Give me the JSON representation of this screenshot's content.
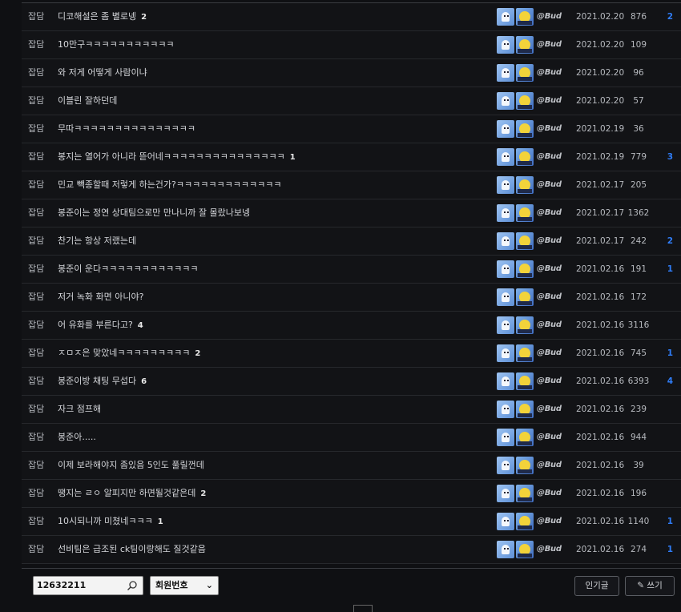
{
  "author": {
    "nickname": "@Bud"
  },
  "posts": [
    {
      "category": "잡담",
      "title": "디코해설은 좀 별로넹",
      "comments": "2",
      "date": "2021.02.20",
      "views": "876",
      "recommend": "2"
    },
    {
      "category": "잡담",
      "title": "10만구ㅋㅋㅋㅋㅋㅋㅋㅋㅋㅋㅋ",
      "comments": "",
      "date": "2021.02.20",
      "views": "109",
      "recommend": ""
    },
    {
      "category": "잡담",
      "title": "와 저게 어떻게 사람이냐",
      "comments": "",
      "date": "2021.02.20",
      "views": "96",
      "recommend": ""
    },
    {
      "category": "잡담",
      "title": "이블린 잘하던데",
      "comments": "",
      "date": "2021.02.20",
      "views": "57",
      "recommend": ""
    },
    {
      "category": "잡담",
      "title": "무따ㅋㅋㅋㅋㅋㅋㅋㅋㅋㅋㅋㅋㅋㅋㅋ",
      "comments": "",
      "date": "2021.02.19",
      "views": "36",
      "recommend": ""
    },
    {
      "category": "잡담",
      "title": "봉지는 열어가 아니라 뜯어네ㅋㅋㅋㅋㅋㅋㅋㅋㅋㅋㅋㅋㅋㅋㅋ",
      "comments": "1",
      "date": "2021.02.19",
      "views": "779",
      "recommend": "3"
    },
    {
      "category": "잡담",
      "title": "민교 빽종할때 저렇게 하는건가?ㅋㅋㅋㅋㅋㅋㅋㅋㅋㅋㅋㅋㅋ",
      "comments": "",
      "date": "2021.02.17",
      "views": "205",
      "recommend": ""
    },
    {
      "category": "잡담",
      "title": "봉준이는 정연 상대팀으로만 만나니까 잘 몰랐나보넹",
      "comments": "",
      "date": "2021.02.17",
      "views": "1362",
      "recommend": ""
    },
    {
      "category": "잡담",
      "title": "찬기는 항상 저랬는데",
      "comments": "",
      "date": "2021.02.17",
      "views": "242",
      "recommend": "2"
    },
    {
      "category": "잡담",
      "title": "봉준이 운다ㅋㅋㅋㅋㅋㅋㅋㅋㅋㅋㅋㅋ",
      "comments": "",
      "date": "2021.02.16",
      "views": "191",
      "recommend": "1"
    },
    {
      "category": "잡담",
      "title": "저거 녹화 화면 아니야?",
      "comments": "",
      "date": "2021.02.16",
      "views": "172",
      "recommend": ""
    },
    {
      "category": "잡담",
      "title": "어 유화를 부른다고?",
      "comments": "4",
      "date": "2021.02.16",
      "views": "3116",
      "recommend": ""
    },
    {
      "category": "잡담",
      "title": "ㅈㅁㅈ은 맞았네ㅋㅋㅋㅋㅋㅋㅋㅋㅋ",
      "comments": "2",
      "date": "2021.02.16",
      "views": "745",
      "recommend": "1"
    },
    {
      "category": "잡담",
      "title": "봉준이방 채팅 무섭다",
      "comments": "6",
      "date": "2021.02.16",
      "views": "6393",
      "recommend": "4"
    },
    {
      "category": "잡담",
      "title": "자크 점프해",
      "comments": "",
      "date": "2021.02.16",
      "views": "239",
      "recommend": ""
    },
    {
      "category": "잡담",
      "title": "봉준아.....",
      "comments": "",
      "date": "2021.02.16",
      "views": "944",
      "recommend": ""
    },
    {
      "category": "잡담",
      "title": "이제 보라해야지 좀있음 5인도 풀릴껀데",
      "comments": "",
      "date": "2021.02.16",
      "views": "39",
      "recommend": ""
    },
    {
      "category": "잡담",
      "title": "땡지는 ㄹㅇ 알피지만 하면될것같은데",
      "comments": "2",
      "date": "2021.02.16",
      "views": "196",
      "recommend": ""
    },
    {
      "category": "잡담",
      "title": "10시되니까 미쳤네ㅋㅋㅋ",
      "comments": "1",
      "date": "2021.02.16",
      "views": "1140",
      "recommend": "1"
    },
    {
      "category": "잡담",
      "title": "선비팀은 급조된 ck팀이랑해도 질것같음",
      "comments": "",
      "date": "2021.02.16",
      "views": "274",
      "recommend": "1"
    }
  ],
  "search": {
    "value": "12632211",
    "select_value": "회원번호"
  },
  "buttons": {
    "popular": "인기글",
    "write": "쓰기"
  },
  "icons": {
    "search": "search-icon",
    "pencil": "pencil-icon",
    "chevron": "chevron-down-icon",
    "avatar1": "ghost-icon",
    "avatar2": "chick-icon"
  },
  "colors": {
    "accent": "#2f7cf6"
  }
}
